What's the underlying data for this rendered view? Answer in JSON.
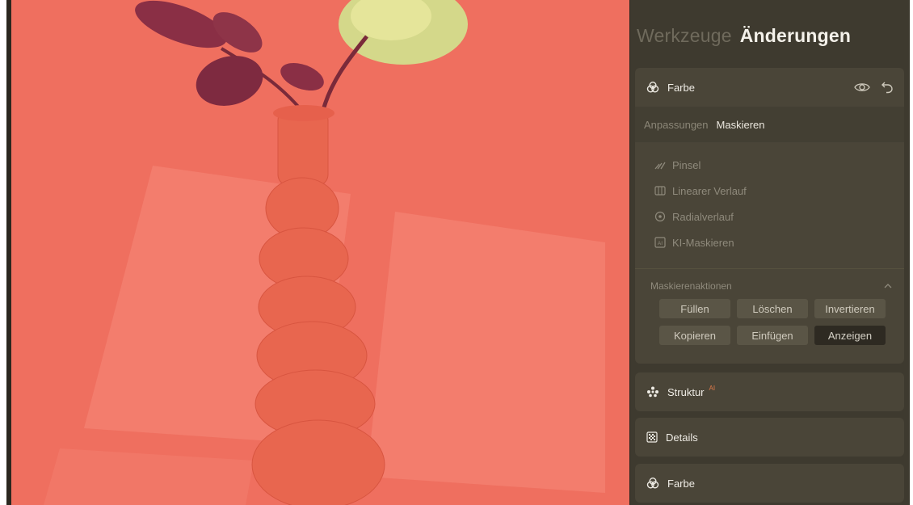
{
  "header": {
    "tab_tools": "Werkzeuge",
    "tab_edits": "Änderungen"
  },
  "color_panel": {
    "title": "Farbe",
    "icons": [
      "color-circles-icon",
      "eye-icon",
      "undo-icon"
    ],
    "subtabs": {
      "adjust": "Anpassungen",
      "mask": "Maskieren"
    },
    "tools": [
      {
        "label": "Pinsel",
        "icon": "brush-icon"
      },
      {
        "label": "Linearer Verlauf",
        "icon": "linear-gradient-icon"
      },
      {
        "label": "Radialverlauf",
        "icon": "radial-gradient-icon"
      },
      {
        "label": "KI-Maskieren",
        "icon": "ai-mask-icon"
      }
    ],
    "mask_actions": {
      "label": "Maskierenaktionen",
      "buttons": {
        "fill": "Füllen",
        "delete": "Löschen",
        "invert": "Invertieren",
        "copy": "Kopieren",
        "paste": "Einfügen",
        "show": "Anzeigen"
      }
    }
  },
  "sections": {
    "structure": "Struktur",
    "structure_badge": "AI",
    "details": "Details",
    "color": "Farbe"
  },
  "colors": {
    "mask_overlay": "#f07060",
    "panel_bg": "#3e3a2f",
    "card_bg": "#4a4538",
    "active_button": "#2e2a22",
    "ai_badge": "#e07a4a"
  }
}
